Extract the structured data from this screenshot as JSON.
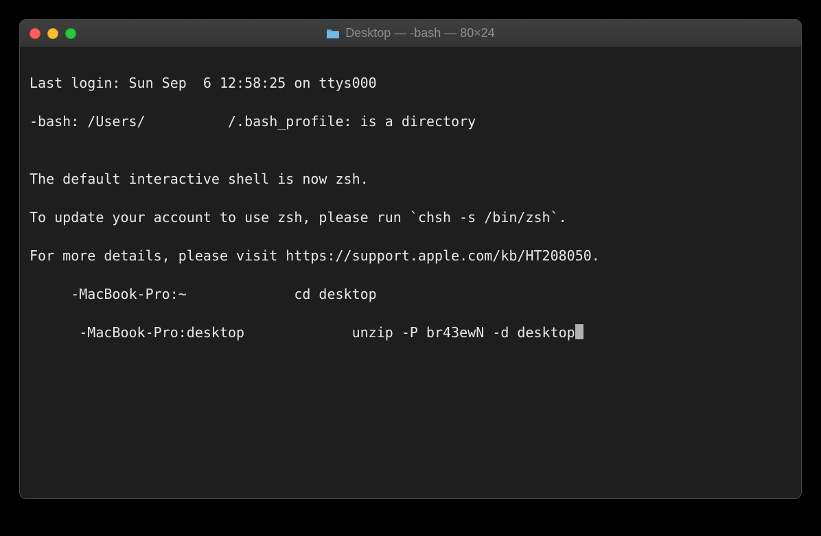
{
  "window": {
    "title": "Desktop — -bash — 80×24",
    "folderIconName": "folder-icon"
  },
  "terminal": {
    "lines": {
      "l0": "Last login: Sun Sep  6 12:58:25 on ttys000",
      "l1": "-bash: /Users/          /.bash_profile: is a directory",
      "l2": "",
      "l3": "The default interactive shell is now zsh.",
      "l4": "To update your account to use zsh, please run `chsh -s /bin/zsh`.",
      "l5": "For more details, please visit https://support.apple.com/kb/HT208050.",
      "l6": "     -MacBook-Pro:~             cd desktop",
      "l7": "      -MacBook-Pro:desktop             unzip -P br43ewN -d desktop"
    }
  }
}
